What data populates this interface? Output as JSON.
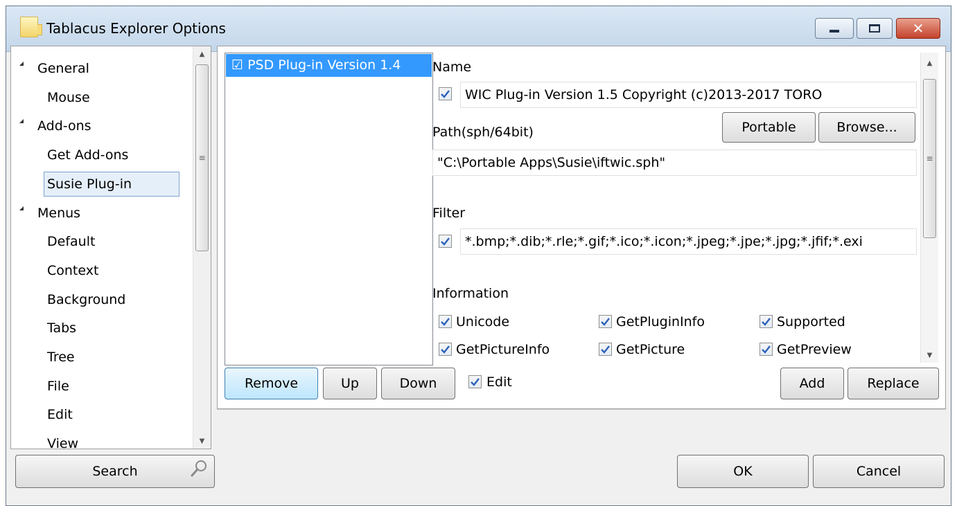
{
  "window": {
    "title": "Tablacus Explorer Options"
  },
  "tree": {
    "items": [
      {
        "label": "General",
        "level": 0,
        "expanded": true
      },
      {
        "label": "Mouse",
        "level": 1
      },
      {
        "label": "Add-ons",
        "level": 0,
        "expanded": true
      },
      {
        "label": "Get Add-ons",
        "level": 1
      },
      {
        "label": "Susie Plug-in",
        "level": 1,
        "selected": true
      },
      {
        "label": "Menus",
        "level": 0,
        "expanded": true
      },
      {
        "label": "Default",
        "level": 1
      },
      {
        "label": "Context",
        "level": 1
      },
      {
        "label": "Background",
        "level": 1
      },
      {
        "label": "Tabs",
        "level": 1
      },
      {
        "label": "Tree",
        "level": 1
      },
      {
        "label": "File",
        "level": 1
      },
      {
        "label": "Edit",
        "level": 1
      },
      {
        "label": "View",
        "level": 1
      }
    ]
  },
  "plugin_list": {
    "items": [
      {
        "label": "☑ PSD Plug-in Version 1.4",
        "selected": true
      }
    ]
  },
  "details": {
    "name_label": "Name",
    "name_value": "WIC Plug-in Version 1.5 Copyright (c)2013-2017 TORO",
    "name_checked": true,
    "path_label": "Path(sph/64bit)",
    "path_value": "\"C:\\Portable Apps\\Susie\\iftwic.sph\"",
    "portable_label": "Portable",
    "browse_label": "Browse...",
    "filter_label": "Filter",
    "filter_value": "*.bmp;*.dib;*.rle;*.gif;*.ico;*.icon;*.jpeg;*.jpe;*.jpg;*.jfif;*.exi",
    "filter_checked": true,
    "information_label": "Information",
    "info_items": [
      {
        "label": "Unicode",
        "checked": true
      },
      {
        "label": "GetPluginInfo",
        "checked": true
      },
      {
        "label": "Supported",
        "checked": true
      },
      {
        "label": "GetPictureInfo",
        "checked": true
      },
      {
        "label": "GetPicture",
        "checked": true
      },
      {
        "label": "GetPreview",
        "checked": true
      }
    ]
  },
  "actions": {
    "remove": "Remove",
    "up": "Up",
    "down": "Down",
    "edit": "Edit",
    "edit_checked": true,
    "add": "Add",
    "replace": "Replace"
  },
  "footer": {
    "search": "Search",
    "ok": "OK",
    "cancel": "Cancel"
  },
  "colors": {
    "selection": "#3399ff",
    "check": "#2a62b8"
  }
}
